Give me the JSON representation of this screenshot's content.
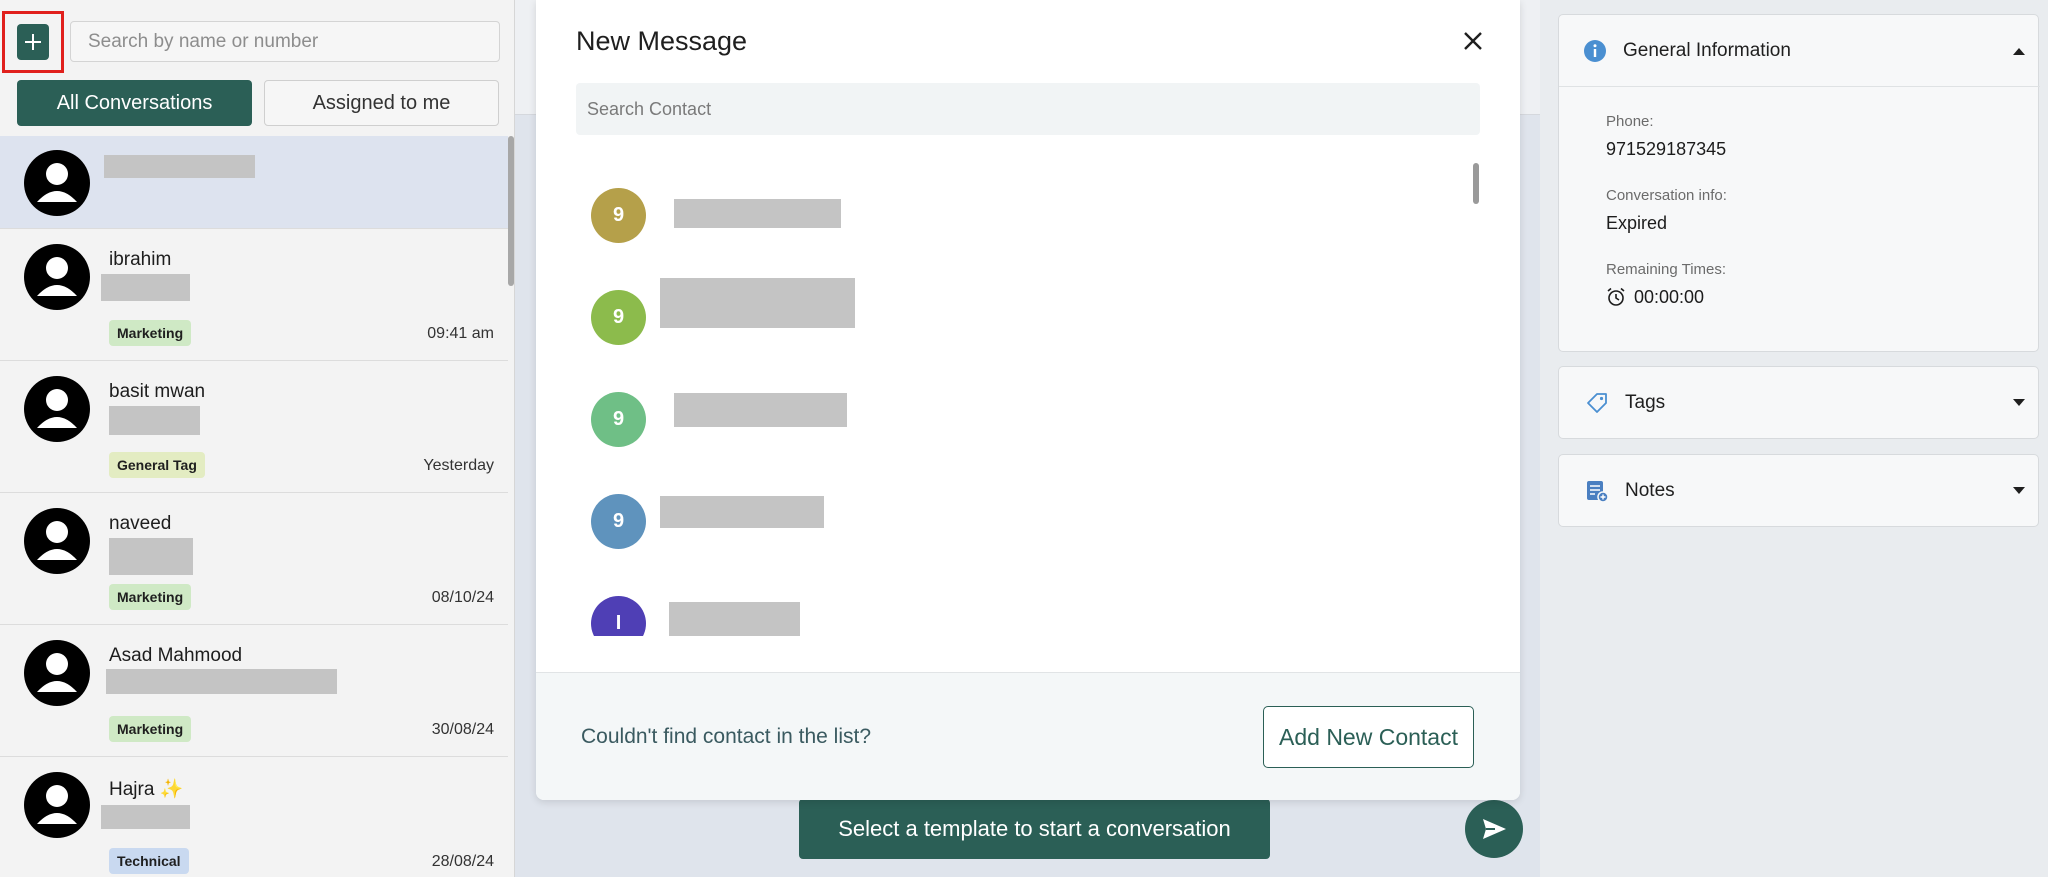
{
  "sidebar": {
    "search_placeholder": "Search by name or number",
    "tabs": [
      {
        "label": "All Conversations",
        "active": true
      },
      {
        "label": "Assigned to me",
        "active": false
      }
    ],
    "conversations": [
      {
        "name": "",
        "tag": "",
        "time": ""
      },
      {
        "name": "ibrahim",
        "tag": "Marketing",
        "time": "09:41 am"
      },
      {
        "name": "basit mwan",
        "tag": "General Tag",
        "time": "Yesterday"
      },
      {
        "name": "naveed",
        "tag": "Marketing",
        "time": "08/10/24"
      },
      {
        "name": "Asad Mahmood",
        "tag": "Marketing",
        "time": "30/08/24"
      },
      {
        "name": "Hajra ✨",
        "tag": "Technical",
        "time": "28/08/24"
      }
    ]
  },
  "modal": {
    "title": "New Message",
    "search_placeholder": "Search Contact",
    "contacts": [
      {
        "initial": "9",
        "color": "#b5a04a"
      },
      {
        "initial": "9",
        "color": "#8cbb4c"
      },
      {
        "initial": "9",
        "color": "#6fbf86"
      },
      {
        "initial": "9",
        "color": "#5f93bd"
      },
      {
        "initial": "I",
        "color": "#4f3fb5"
      }
    ],
    "footer_text": "Couldn't find contact in the list?",
    "add_contact_label": "Add New Contact"
  },
  "chat": {
    "template_button": "Select a template to start a conversation"
  },
  "right_panel": {
    "general_info": {
      "title": "General Information",
      "phone_label": "Phone:",
      "phone": "971529187345",
      "conv_info_label": "Conversation info:",
      "conv_info": "Expired",
      "remaining_label": "Remaining Times:",
      "remaining": "00:00:00"
    },
    "tags_title": "Tags",
    "notes_title": "Notes"
  },
  "colors": {
    "primary": "#2b5f56",
    "info_icon": "#4a8fd1",
    "highlight": "#e0201c"
  }
}
